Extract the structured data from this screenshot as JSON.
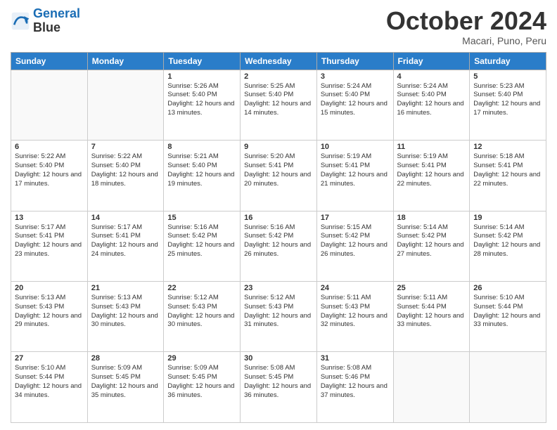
{
  "header": {
    "logo_line1": "General",
    "logo_line2": "Blue",
    "month": "October 2024",
    "location": "Macari, Puno, Peru"
  },
  "days_of_week": [
    "Sunday",
    "Monday",
    "Tuesday",
    "Wednesday",
    "Thursday",
    "Friday",
    "Saturday"
  ],
  "weeks": [
    [
      {
        "day": "",
        "info": ""
      },
      {
        "day": "",
        "info": ""
      },
      {
        "day": "1",
        "info": "Sunrise: 5:26 AM\nSunset: 5:40 PM\nDaylight: 12 hours and 13 minutes."
      },
      {
        "day": "2",
        "info": "Sunrise: 5:25 AM\nSunset: 5:40 PM\nDaylight: 12 hours and 14 minutes."
      },
      {
        "day": "3",
        "info": "Sunrise: 5:24 AM\nSunset: 5:40 PM\nDaylight: 12 hours and 15 minutes."
      },
      {
        "day": "4",
        "info": "Sunrise: 5:24 AM\nSunset: 5:40 PM\nDaylight: 12 hours and 16 minutes."
      },
      {
        "day": "5",
        "info": "Sunrise: 5:23 AM\nSunset: 5:40 PM\nDaylight: 12 hours and 17 minutes."
      }
    ],
    [
      {
        "day": "6",
        "info": "Sunrise: 5:22 AM\nSunset: 5:40 PM\nDaylight: 12 hours and 17 minutes."
      },
      {
        "day": "7",
        "info": "Sunrise: 5:22 AM\nSunset: 5:40 PM\nDaylight: 12 hours and 18 minutes."
      },
      {
        "day": "8",
        "info": "Sunrise: 5:21 AM\nSunset: 5:40 PM\nDaylight: 12 hours and 19 minutes."
      },
      {
        "day": "9",
        "info": "Sunrise: 5:20 AM\nSunset: 5:41 PM\nDaylight: 12 hours and 20 minutes."
      },
      {
        "day": "10",
        "info": "Sunrise: 5:19 AM\nSunset: 5:41 PM\nDaylight: 12 hours and 21 minutes."
      },
      {
        "day": "11",
        "info": "Sunrise: 5:19 AM\nSunset: 5:41 PM\nDaylight: 12 hours and 22 minutes."
      },
      {
        "day": "12",
        "info": "Sunrise: 5:18 AM\nSunset: 5:41 PM\nDaylight: 12 hours and 22 minutes."
      }
    ],
    [
      {
        "day": "13",
        "info": "Sunrise: 5:17 AM\nSunset: 5:41 PM\nDaylight: 12 hours and 23 minutes."
      },
      {
        "day": "14",
        "info": "Sunrise: 5:17 AM\nSunset: 5:41 PM\nDaylight: 12 hours and 24 minutes."
      },
      {
        "day": "15",
        "info": "Sunrise: 5:16 AM\nSunset: 5:42 PM\nDaylight: 12 hours and 25 minutes."
      },
      {
        "day": "16",
        "info": "Sunrise: 5:16 AM\nSunset: 5:42 PM\nDaylight: 12 hours and 26 minutes."
      },
      {
        "day": "17",
        "info": "Sunrise: 5:15 AM\nSunset: 5:42 PM\nDaylight: 12 hours and 26 minutes."
      },
      {
        "day": "18",
        "info": "Sunrise: 5:14 AM\nSunset: 5:42 PM\nDaylight: 12 hours and 27 minutes."
      },
      {
        "day": "19",
        "info": "Sunrise: 5:14 AM\nSunset: 5:42 PM\nDaylight: 12 hours and 28 minutes."
      }
    ],
    [
      {
        "day": "20",
        "info": "Sunrise: 5:13 AM\nSunset: 5:43 PM\nDaylight: 12 hours and 29 minutes."
      },
      {
        "day": "21",
        "info": "Sunrise: 5:13 AM\nSunset: 5:43 PM\nDaylight: 12 hours and 30 minutes."
      },
      {
        "day": "22",
        "info": "Sunrise: 5:12 AM\nSunset: 5:43 PM\nDaylight: 12 hours and 30 minutes."
      },
      {
        "day": "23",
        "info": "Sunrise: 5:12 AM\nSunset: 5:43 PM\nDaylight: 12 hours and 31 minutes."
      },
      {
        "day": "24",
        "info": "Sunrise: 5:11 AM\nSunset: 5:43 PM\nDaylight: 12 hours and 32 minutes."
      },
      {
        "day": "25",
        "info": "Sunrise: 5:11 AM\nSunset: 5:44 PM\nDaylight: 12 hours and 33 minutes."
      },
      {
        "day": "26",
        "info": "Sunrise: 5:10 AM\nSunset: 5:44 PM\nDaylight: 12 hours and 33 minutes."
      }
    ],
    [
      {
        "day": "27",
        "info": "Sunrise: 5:10 AM\nSunset: 5:44 PM\nDaylight: 12 hours and 34 minutes."
      },
      {
        "day": "28",
        "info": "Sunrise: 5:09 AM\nSunset: 5:45 PM\nDaylight: 12 hours and 35 minutes."
      },
      {
        "day": "29",
        "info": "Sunrise: 5:09 AM\nSunset: 5:45 PM\nDaylight: 12 hours and 36 minutes."
      },
      {
        "day": "30",
        "info": "Sunrise: 5:08 AM\nSunset: 5:45 PM\nDaylight: 12 hours and 36 minutes."
      },
      {
        "day": "31",
        "info": "Sunrise: 5:08 AM\nSunset: 5:46 PM\nDaylight: 12 hours and 37 minutes."
      },
      {
        "day": "",
        "info": ""
      },
      {
        "day": "",
        "info": ""
      }
    ]
  ]
}
